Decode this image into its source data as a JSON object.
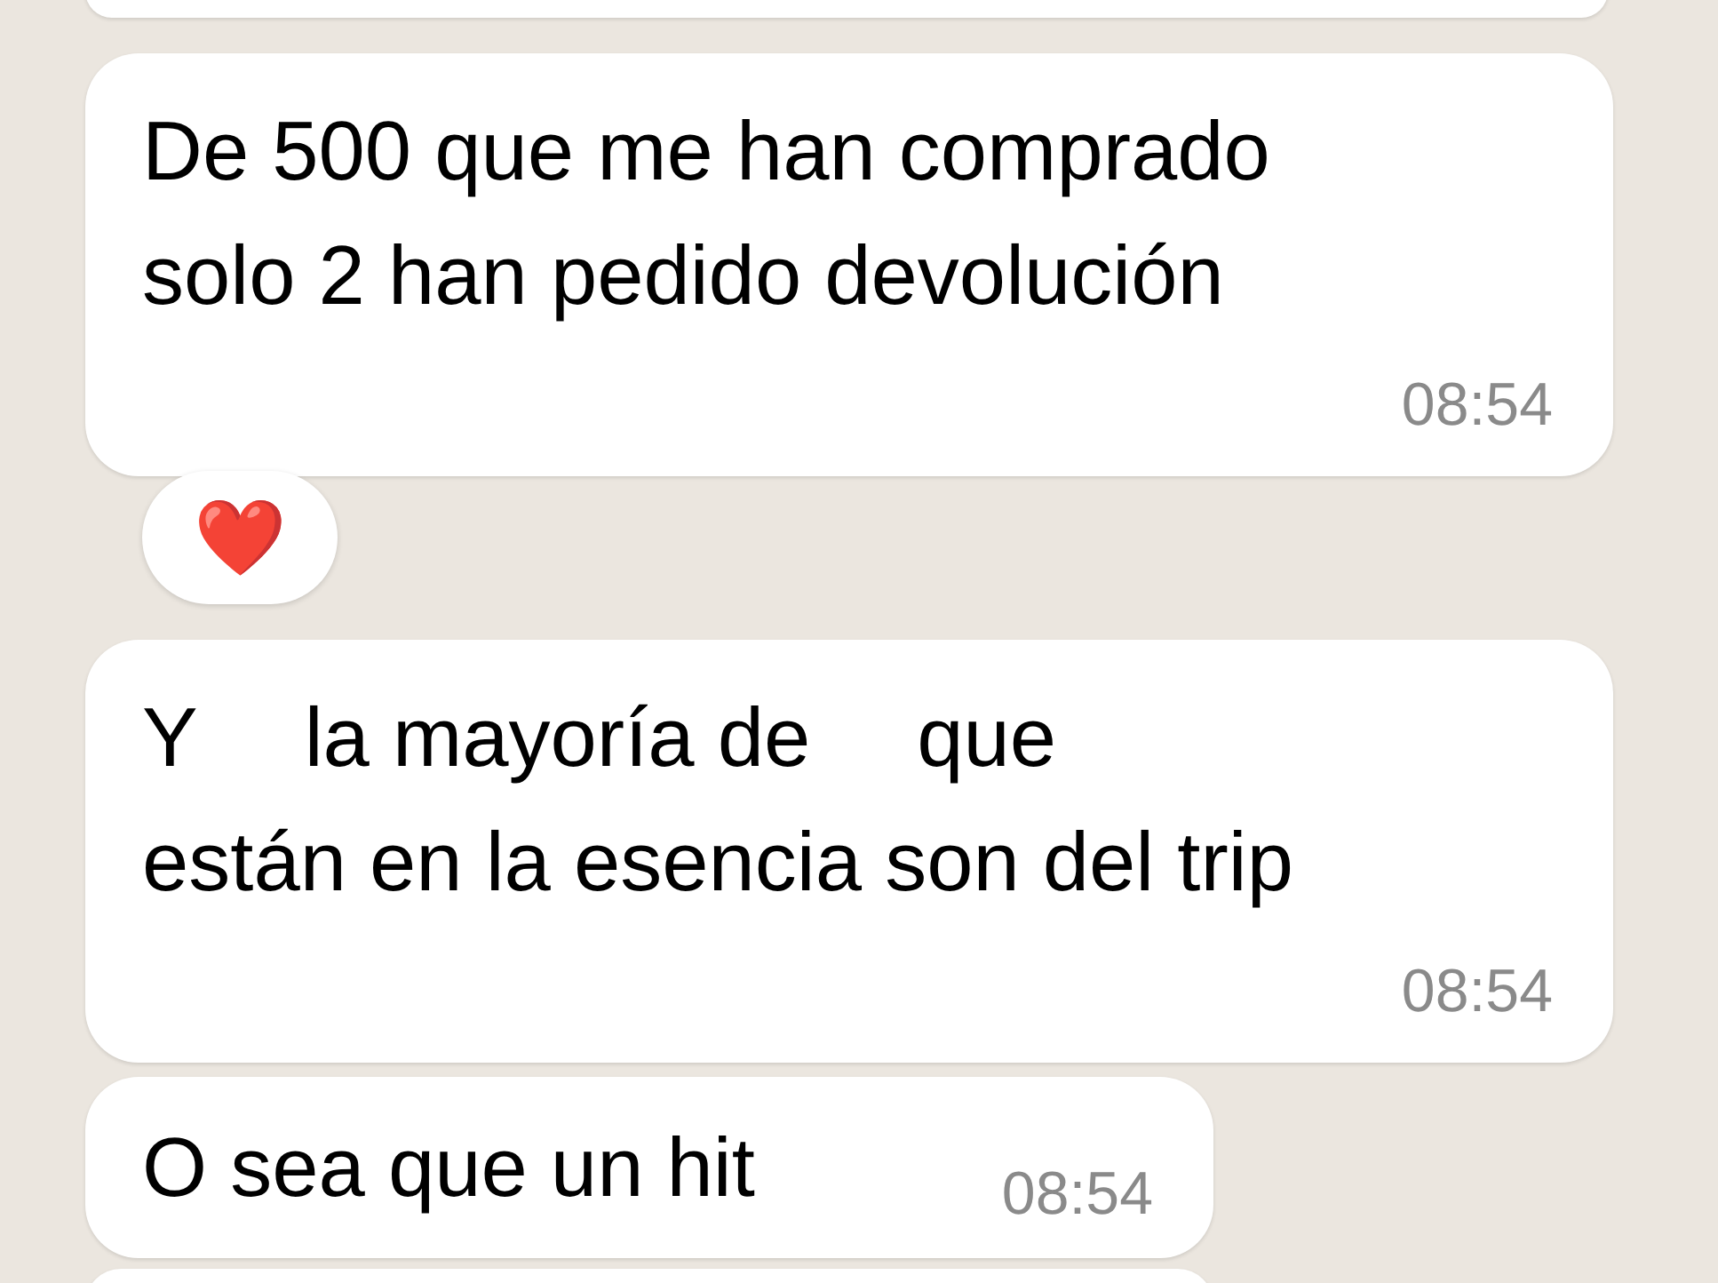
{
  "messages": [
    {
      "kind": "partial"
    },
    {
      "kind": "bubble",
      "lines": [
        [
          {
            "kind": "text",
            "text": "De 500 que me han comprado"
          }
        ],
        [
          {
            "kind": "text",
            "text": "solo 2 han pedido devolución"
          }
        ]
      ],
      "time": "08:54",
      "reaction": "❤️"
    },
    {
      "kind": "bubble",
      "lines": [
        [
          {
            "kind": "text",
            "text": "Y"
          },
          {
            "kind": "redacted"
          },
          {
            "kind": "text",
            "text": "la mayoría de"
          },
          {
            "kind": "redacted"
          },
          {
            "kind": "text",
            "text": "que"
          }
        ],
        [
          {
            "kind": "text",
            "text": "están en la esencia son del trip"
          }
        ]
      ],
      "time": "08:54"
    },
    {
      "kind": "inline",
      "lines": [
        [
          {
            "kind": "text",
            "text": "O sea que un hit"
          }
        ]
      ],
      "time": "08:54"
    },
    {
      "kind": "partial"
    }
  ]
}
